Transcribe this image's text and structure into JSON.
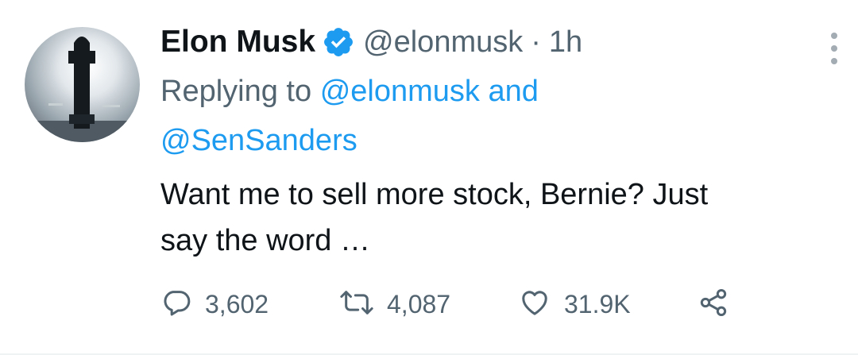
{
  "author": {
    "display_name": "Elon Musk",
    "handle": "@elonmusk",
    "separator": "·",
    "timestamp": "1h"
  },
  "reply": {
    "prefix": "Replying to",
    "mention_1": "@elonmusk",
    "conjunction": "and",
    "mention_2": "@SenSanders"
  },
  "body": {
    "line_1": "Want me to sell more stock, Bernie? Just",
    "line_2": "say the word …"
  },
  "actions": {
    "replies": "3,602",
    "retweets": "4,087",
    "likes": "31.9K"
  },
  "colors": {
    "accent": "#1d9bf0",
    "muted": "#536471",
    "text": "#0f1419"
  },
  "icons": {
    "verified": "verified-badge-icon",
    "more": "more-options-icon",
    "reply": "reply-icon",
    "retweet": "retweet-icon",
    "like": "heart-icon",
    "share": "share-icon"
  }
}
